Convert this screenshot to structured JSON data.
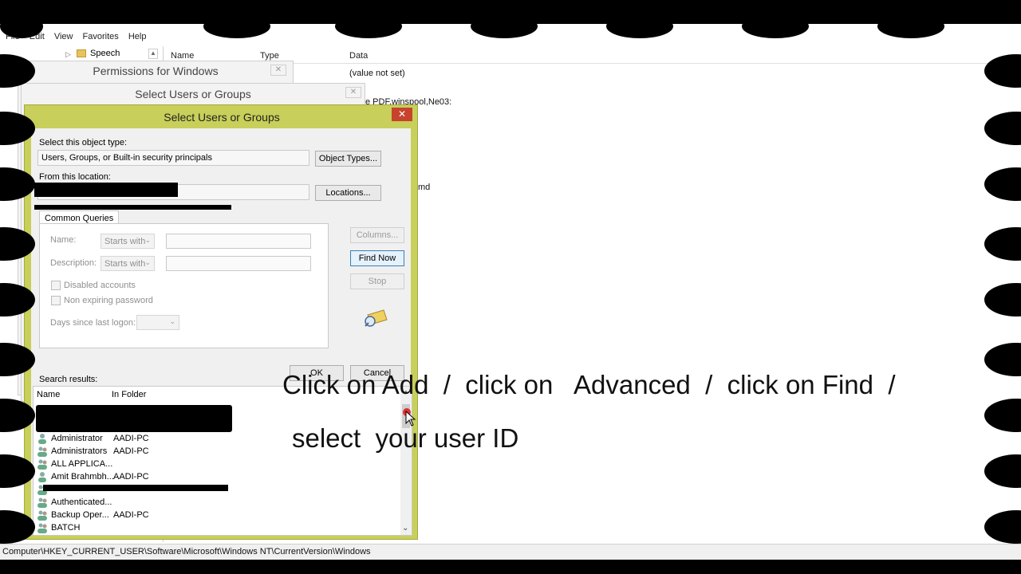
{
  "menu": [
    "File",
    "Edit",
    "View",
    "Favorites",
    "Help"
  ],
  "tree": {
    "node_label": "Speech"
  },
  "list": {
    "columns": [
      "Name",
      "Type",
      "Data"
    ],
    "data_values": [
      "(value not set)",
      "e PDF,winspool,Ne03:",
      "md"
    ]
  },
  "ghost_dialogs": {
    "permissions_title": "Permissions for Windows",
    "select_title_back": "Select Users or Groups",
    "close_glyph": "✕"
  },
  "dialog": {
    "title": "Select Users or Groups",
    "close_glyph": "✕",
    "object_type_label": "Select this object type:",
    "object_type_value": "Users, Groups, or Built-in security principals",
    "object_types_button": "Object Types...",
    "location_label": "From this location:",
    "locations_button": "Locations...",
    "tab_label": "Common Queries",
    "name_label": "Name:",
    "description_label": "Description:",
    "starts_with": "Starts with",
    "disabled_accounts": "Disabled accounts",
    "non_expiring_password": "Non expiring password",
    "days_since_logon": "Days since last logon:",
    "columns_button": "Columns...",
    "find_now_button": "Find Now",
    "stop_button": "Stop",
    "ok_button": "OK",
    "cancel_button": "Cancel",
    "search_results_label": "Search results:",
    "results_columns": [
      "Name",
      "In Folder"
    ],
    "results": [
      {
        "name": "Administrator",
        "folder": "AADI-PC",
        "icon": "user-icon"
      },
      {
        "name": "Administrators",
        "folder": "AADI-PC",
        "icon": "group-icon"
      },
      {
        "name": "ALL APPLICA...",
        "folder": "",
        "icon": "group-icon"
      },
      {
        "name": "Amit Brahmbh...",
        "folder": "AADI-PC",
        "icon": "user-icon"
      },
      {
        "name": "",
        "folder": "",
        "icon": "group-icon"
      },
      {
        "name": "Authenticated...",
        "folder": "",
        "icon": "group-icon"
      },
      {
        "name": "Backup Oper...",
        "folder": "AADI-PC",
        "icon": "group-icon"
      },
      {
        "name": "BATCH",
        "folder": "",
        "icon": "group-icon"
      }
    ]
  },
  "statusbar": {
    "path": "Computer\\HKEY_CURRENT_USER\\Software\\Microsoft\\Windows NT\\CurrentVersion\\Windows"
  },
  "caption": {
    "line1": "Click on Add  /  click on   Advanced  /  click on Find  /",
    "line2": "select  your user ID"
  }
}
